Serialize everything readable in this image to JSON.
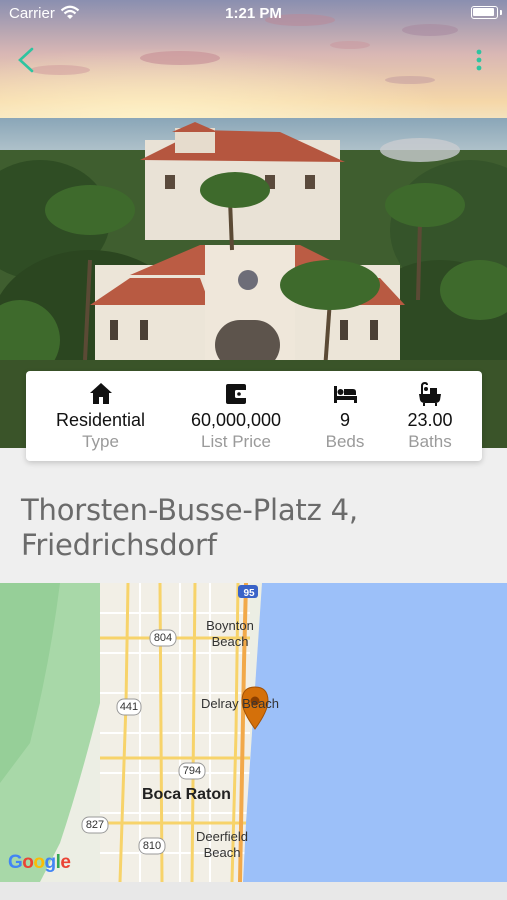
{
  "status_bar": {
    "carrier": "Carrier",
    "time": "1:21 PM"
  },
  "accent_color": "#2ec4a0",
  "stats": [
    {
      "icon": "home-icon",
      "value": "Residential",
      "label": "Type",
      "bold": false
    },
    {
      "icon": "wallet-icon",
      "value": "60,000,000",
      "label": "List Price",
      "bold": false
    },
    {
      "icon": "bed-icon",
      "value": "9",
      "label": "Beds",
      "bold": false
    },
    {
      "icon": "bathtub-icon",
      "value": "23.00",
      "label": "Baths",
      "bold": false
    }
  ],
  "address": {
    "line1": "Thorsten-Busse-Platz 4,",
    "line2": "Friedrichsdorf"
  },
  "map": {
    "labels": {
      "boynton": "Boynton Beach",
      "delray": "Delray Beach",
      "boca": "Boca Raton",
      "deerfield": "Deerfield Beach"
    },
    "shields": {
      "i95": "95",
      "r804": "804",
      "r441": "441",
      "r794": "794",
      "r827": "827",
      "r810": "810"
    },
    "google": "Google"
  }
}
